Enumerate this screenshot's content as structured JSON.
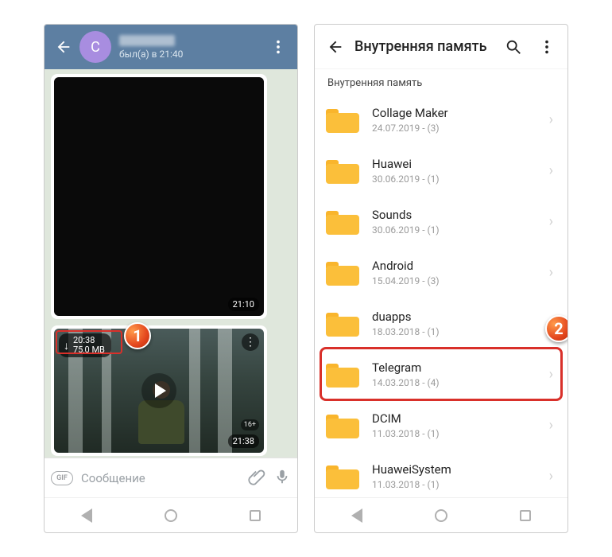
{
  "telegram": {
    "avatar_letter": "C",
    "status": "был(а) в 21:40",
    "image_msg_time": "21:10",
    "video": {
      "download_duration": "20:38",
      "download_size": "75,0 МВ",
      "age_rating": "16+",
      "time": "21:38"
    },
    "input": {
      "gif_label": "GIF",
      "placeholder": "Сообщение"
    }
  },
  "filemanager": {
    "title": "Внутренняя память",
    "breadcrumb": "Внутренняя память",
    "items": [
      {
        "name": "Collage Maker",
        "sub": "24.07.2019 - (3)"
      },
      {
        "name": "Huawei",
        "sub": "30.06.2019 - (1)"
      },
      {
        "name": "Sounds",
        "sub": "30.06.2019 - (1)"
      },
      {
        "name": "Android",
        "sub": "15.04.2019 - (3)"
      },
      {
        "name": "duapps",
        "sub": "18.03.2018 - (1)"
      },
      {
        "name": "Telegram",
        "sub": "14.03.2018 - (4)"
      },
      {
        "name": "DCIM",
        "sub": "11.03.2018 - (1)"
      },
      {
        "name": "HuaweiSystem",
        "sub": "11.03.2018 - (1)"
      }
    ],
    "highlight_index": 5
  },
  "callouts": {
    "one": "1",
    "two": "2"
  }
}
